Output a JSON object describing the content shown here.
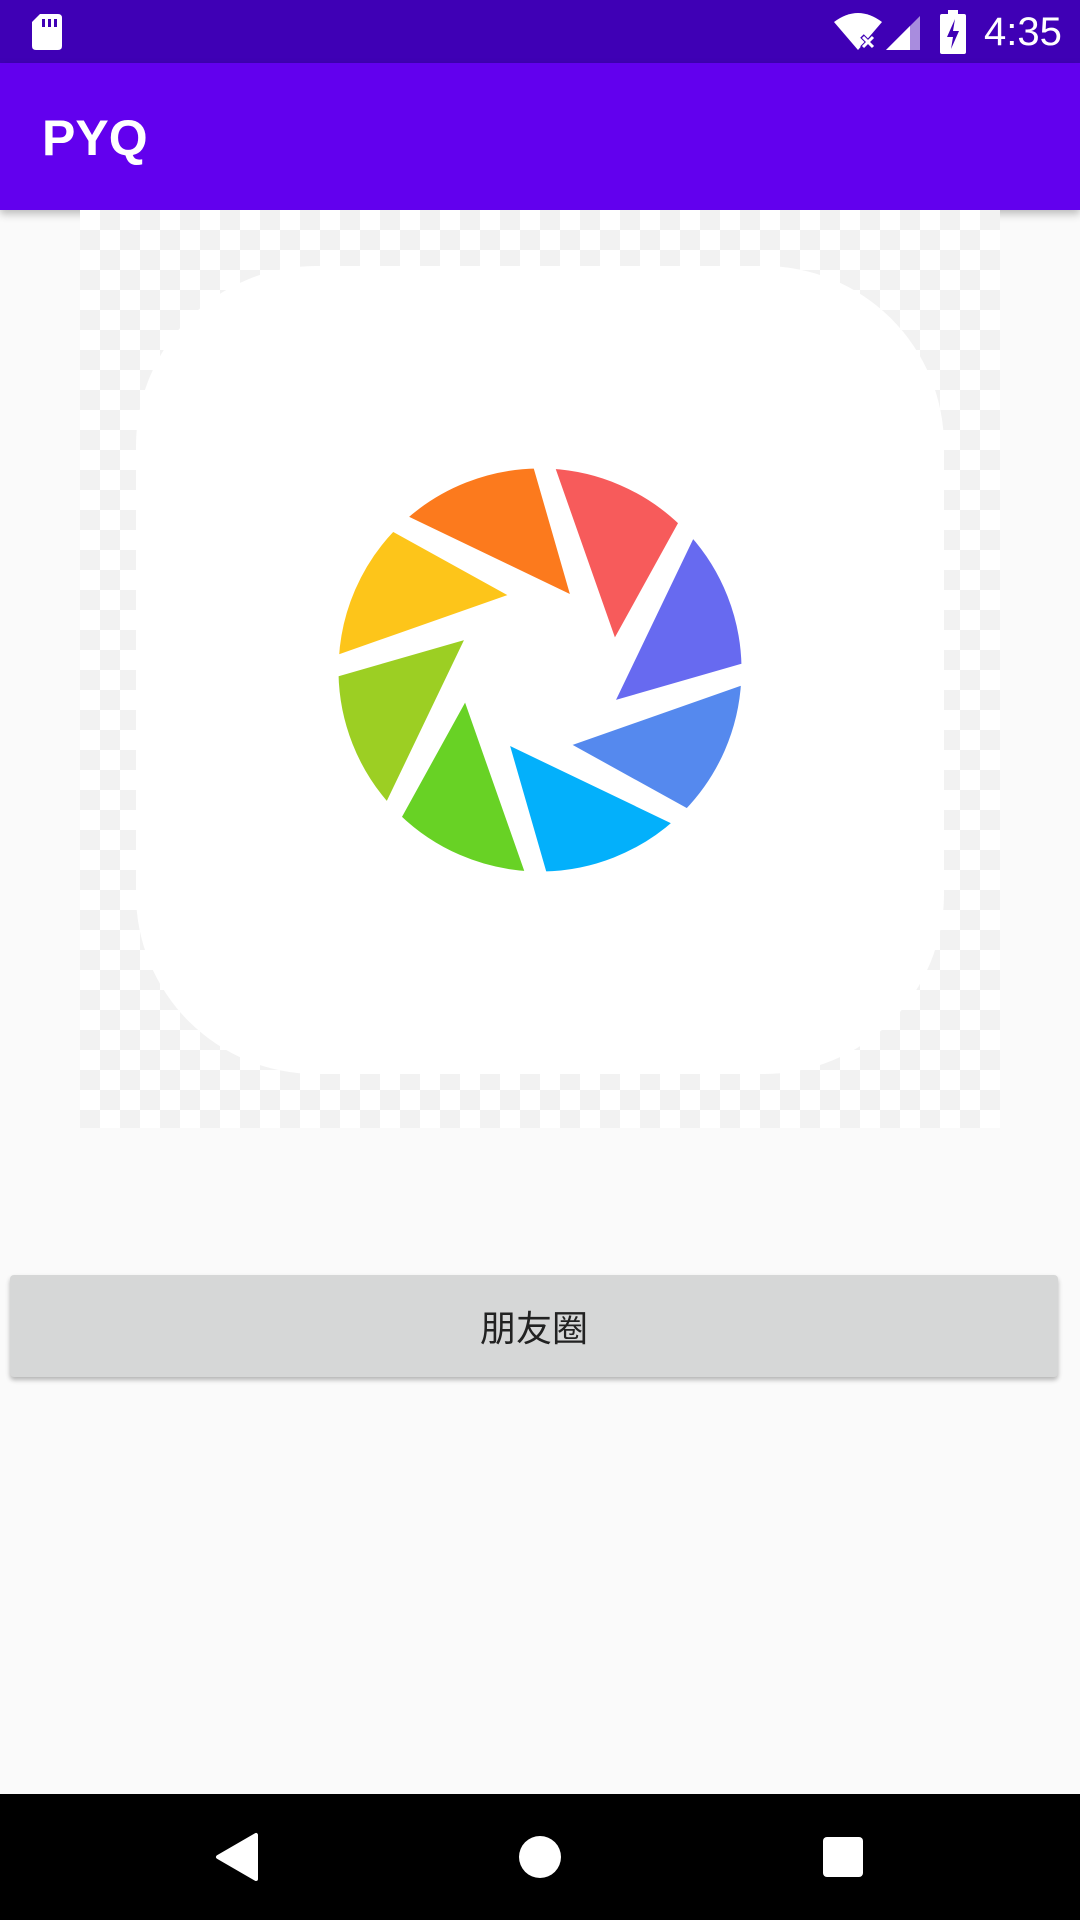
{
  "status_bar": {
    "time": "4:35",
    "icons": [
      "sd-card-icon",
      "wifi-off-icon",
      "signal-icon",
      "battery-charging-icon"
    ]
  },
  "app_bar": {
    "title": "PYQ"
  },
  "main": {
    "image": {
      "icon": "aperture-logo-icon",
      "background": "transparency-checkerboard"
    },
    "button_label": "朋友圈"
  },
  "nav_bar": {
    "icons": [
      "back-icon",
      "home-icon",
      "recents-icon"
    ]
  },
  "colors": {
    "status_bar": "#3f00b5",
    "app_bar": "#6200ee",
    "button": "#d6d7d7",
    "aperture": [
      "#f75b5b",
      "#676af0",
      "#5589ee",
      "#03b0fb",
      "#68d225",
      "#9ccf23",
      "#fdc51a",
      "#fc7a1d"
    ]
  }
}
